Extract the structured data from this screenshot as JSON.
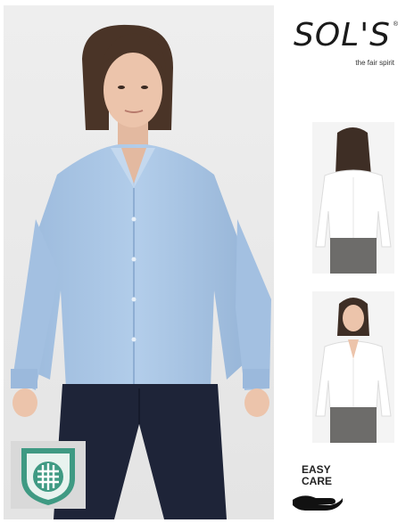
{
  "brand": {
    "logo_text": "SOL'S",
    "registered_mark": "®",
    "tagline": "the fair spirit"
  },
  "images": {
    "main": "woman-blue-oxford-shirt-front-photo",
    "back_view": "white-shirt-back-view-photo",
    "front_view": "white-shirt-front-view-photo"
  },
  "badges": {
    "fabric_icon": "woven-fabric-shield-icon",
    "care_icon": "hand-care-icon",
    "care_line1": "EASY",
    "care_line2": "CARE"
  },
  "colors": {
    "shirt_blue": "#a9c6e6",
    "trousers_navy": "#1e2438",
    "badge_green": "#3f9a83",
    "skirt_grey": "#6d6c6a"
  }
}
